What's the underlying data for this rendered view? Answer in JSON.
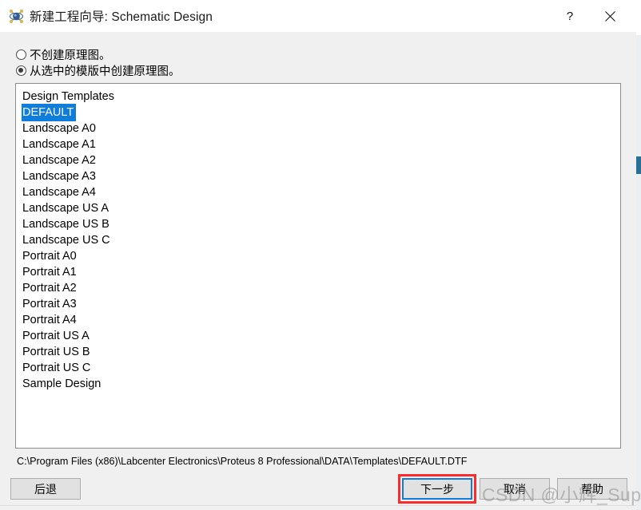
{
  "window": {
    "title": "新建工程向导: Schematic Design",
    "icon": "proteus-atom-icon",
    "help_label": "?",
    "close_label": "✕"
  },
  "options": {
    "none": {
      "label": "不创建原理图。",
      "selected": false
    },
    "from_template": {
      "label": "从选中的模版中创建原理图。",
      "selected": true
    }
  },
  "template_list": {
    "header": "Design Templates",
    "selected": "DEFAULT",
    "items": [
      "DEFAULT",
      "Landscape A0",
      "Landscape A1",
      "Landscape A2",
      "Landscape A3",
      "Landscape A4",
      "Landscape US A",
      "Landscape US B",
      "Landscape US C",
      "Portrait A0",
      "Portrait A1",
      "Portrait A2",
      "Portrait A3",
      "Portrait A4",
      "Portrait US A",
      "Portrait US B",
      "Portrait US C",
      "Sample Design"
    ]
  },
  "path": "C:\\Program Files (x86)\\Labcenter Electronics\\Proteus 8 Professional\\DATA\\Templates\\DEFAULT.DTF",
  "footer": {
    "back_label": "后退",
    "next_label": "下一步",
    "cancel_label": "取消",
    "help_label": "帮助"
  },
  "annotation": {
    "highlight_target": "next-button",
    "highlight_color": "#fb2c2c"
  },
  "watermark": {
    "text": "CSDN @小辉_Super"
  },
  "colors": {
    "selection_blue": "#0f7ddb",
    "dialog_background": "#f0f0f0",
    "titlebar_background": "#ffffff",
    "listbox_background": "#ffffff",
    "button_face": "#e1e1e1"
  }
}
